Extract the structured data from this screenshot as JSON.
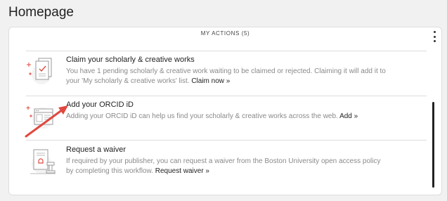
{
  "page": {
    "title": "Homepage"
  },
  "card": {
    "header": "MY ACTIONS (5)",
    "menu_icon": "vertical-dots-icon"
  },
  "items": [
    {
      "title": "Claim your scholarly & creative works",
      "desc_line1": "You have 1 pending scholarly & creative work waiting to be claimed or rejected. Claiming it will add it to",
      "desc_line2": "your 'My scholarly & creative works' list.",
      "action": "Claim now »",
      "icon": "document-check-icon"
    },
    {
      "title": "Add your ORCID iD",
      "desc_line1": "Adding your ORCID iD can help us find your scholarly & creative works across the web.",
      "action": "Add »",
      "icon": "browser-window-icon"
    },
    {
      "title": "Request a waiver",
      "desc_line1": "If required by your publisher, you can request a waiver from the Boston University open access policy",
      "desc_line2": "by completing this workflow.",
      "action": "Request waiver »",
      "icon": "stamp-document-icon"
    }
  ],
  "colors": {
    "accent_red": "#e0483f",
    "background": "#f1f1f1",
    "card": "#ffffff"
  }
}
